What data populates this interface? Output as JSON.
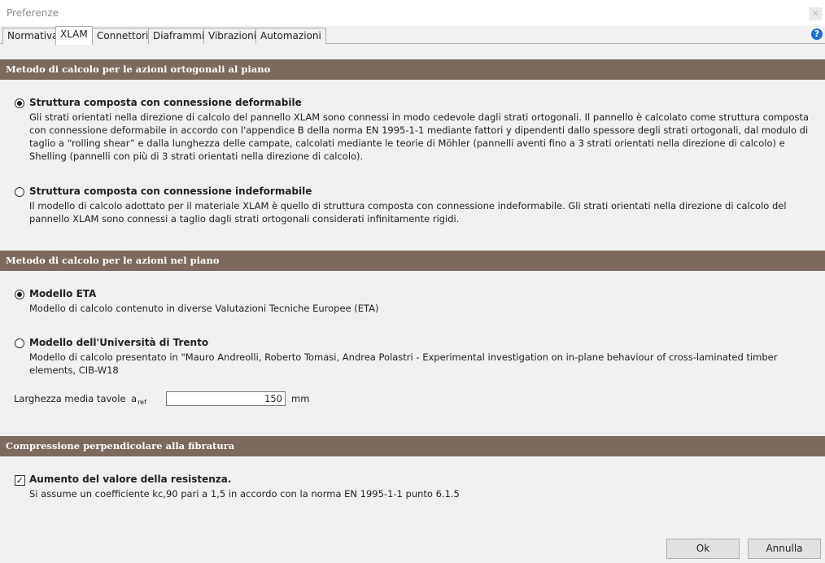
{
  "window": {
    "title": "Preferenze",
    "close_glyph": "×"
  },
  "tabs": [
    {
      "label": "Normativa",
      "active": false
    },
    {
      "label": "XLAM",
      "active": true
    },
    {
      "label": "Connettori",
      "active": false
    },
    {
      "label": "Diaframmi",
      "active": false
    },
    {
      "label": "Vibrazioni",
      "active": false
    },
    {
      "label": "Automazioni",
      "active": false
    }
  ],
  "help": {
    "icon": "help-icon",
    "glyph": "?",
    "color": "#1f6fd0"
  },
  "sections": {
    "orthogonal": {
      "header": "Metodo di calcolo per le azioni ortogonali al piano",
      "options": [
        {
          "title": "Struttura composta con connessione deformabile",
          "description": "Gli strati orientati nella direzione di calcolo del pannello XLAM sono connessi in modo cedevole dagli strati ortogonali. Il pannello è calcolato come struttura composta con connessione deformabile in accordo con l'appendice B della norma EN 1995-1-1 mediante fattori y dipendenti dallo spessore degli strati ortogonali, dal modulo di taglio a “rolling shear” e dalla lunghezza delle campate, calcolati mediante le teorie di Möhler (pannelli aventi fino a 3 strati orientati nella direzione di calcolo) e Shelling (pannelli con più di 3 strati orientati nella direzione di calcolo).",
          "selected": true
        },
        {
          "title": "Struttura composta con connessione indeformabile",
          "description": "Il modello di calcolo adottato per il materiale XLAM è quello di struttura composta con connessione indeformabile. Gli strati orientati nella direzione di calcolo del pannello XLAM sono connessi a taglio dagli strati ortogonali considerati infinitamente rigidi.",
          "selected": false
        }
      ]
    },
    "inplane": {
      "header": "Metodo di calcolo per le azioni nel piano",
      "options": [
        {
          "title": "Modello ETA",
          "description": "Modello di calcolo contenuto in diverse Valutazioni Tecniche Europee (ETA)",
          "selected": true
        },
        {
          "title": "Modello dell'Università di Trento",
          "description": "Modello di calcolo presentato in \"Mauro Andreolli, Roberto Tomasi, Andrea Polastri - Experimental investigation on in-plane behaviour of cross-laminated timber elements, CIB-W18",
          "selected": false
        }
      ],
      "field": {
        "label": "Larghezza media tavole",
        "symbol": "a",
        "symbol_sub": "ref",
        "value": "150",
        "unit": "mm"
      }
    },
    "compression": {
      "header": "Compressione perpendicolare alla fibratura",
      "checkbox": {
        "title": "Aumento del valore della resistenza.",
        "description": "Si assume un coefficiente kc,90 pari a 1,5 in accordo con la norma EN 1995-1-1 punto 6.1.5",
        "checked": true,
        "check_glyph": "✓"
      }
    }
  },
  "buttons": {
    "ok": "Ok",
    "cancel": "Annulla"
  },
  "colors": {
    "section_header": "#7b6a5d",
    "background": "#f0f0f0"
  }
}
